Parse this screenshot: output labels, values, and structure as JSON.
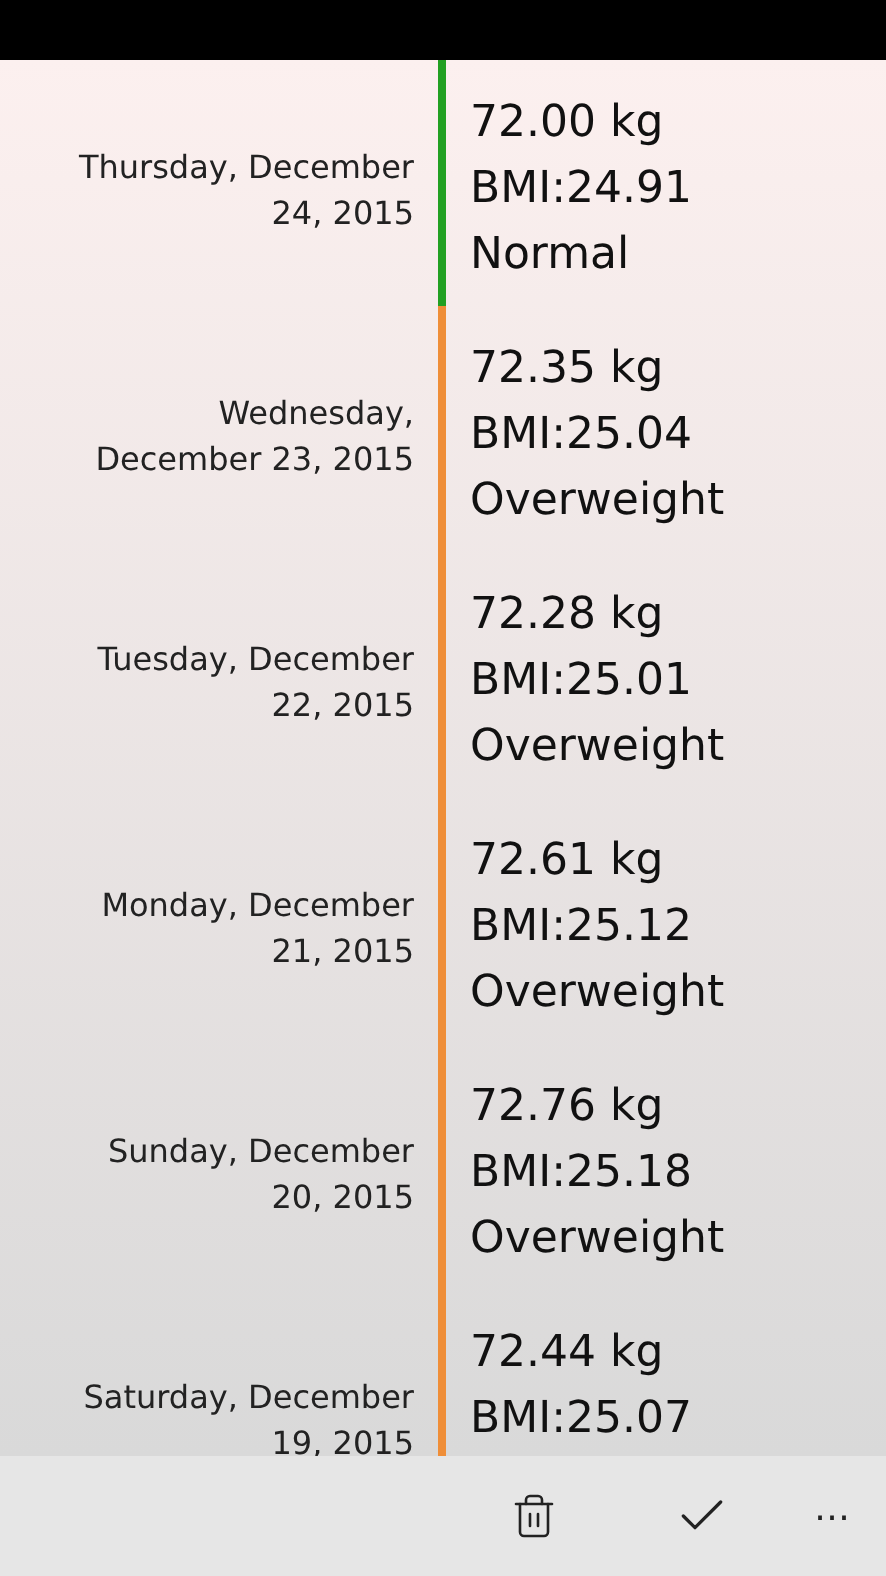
{
  "entries": [
    {
      "date": "Thursday, December 24, 2015",
      "weight": "72.00 kg",
      "bmi": "BMI:24.91",
      "status": "Normal",
      "color": "#22a022"
    },
    {
      "date": "Wednesday, December 23, 2015",
      "weight": "72.35 kg",
      "bmi": "BMI:25.04",
      "status": "Overweight",
      "color": "#ef8e38"
    },
    {
      "date": "Tuesday, December 22, 2015",
      "weight": "72.28 kg",
      "bmi": "BMI:25.01",
      "status": "Overweight",
      "color": "#ef8e38"
    },
    {
      "date": "Monday, December 21, 2015",
      "weight": "72.61 kg",
      "bmi": "BMI:25.12",
      "status": "Overweight",
      "color": "#ef8e38"
    },
    {
      "date": "Sunday, December 20, 2015",
      "weight": "72.76 kg",
      "bmi": "BMI:25.18",
      "status": "Overweight",
      "color": "#ef8e38"
    },
    {
      "date": "Saturday, December 19, 2015",
      "weight": "72.44 kg",
      "bmi": "BMI:25.07",
      "color": "#ef8e38"
    }
  ],
  "app_bar": {
    "more": "…"
  }
}
